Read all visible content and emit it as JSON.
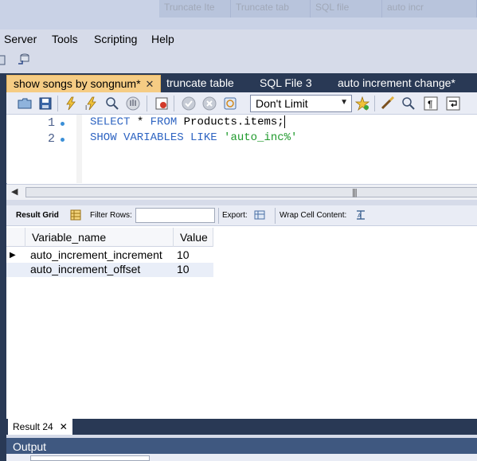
{
  "menu": {
    "items": [
      "Server",
      "Tools",
      "Scripting",
      "Help"
    ]
  },
  "background_tabs": [
    "Truncate Ite",
    "Truncate tab",
    "SQL file",
    "auto incr"
  ],
  "file_tabs": [
    {
      "label": "show songs by songnum*",
      "active": true
    },
    {
      "label": "truncate table",
      "active": false
    },
    {
      "label": "SQL File 3",
      "active": false
    },
    {
      "label": "auto increment change*",
      "active": false
    }
  ],
  "editor_toolbar": {
    "limit_value": "Don't Limit"
  },
  "editor": {
    "line_numbers": [
      "1",
      "2"
    ],
    "line1": {
      "kw1": "SELECT",
      "rest1": " * ",
      "kw2": "FROM",
      "ident": " Products.items;"
    },
    "line2": {
      "kw1": "SHOW VARIABLES LIKE",
      "str": "'auto_inc%'"
    }
  },
  "result_toolbar": {
    "result_grid": "Result Grid",
    "filter_rows": "Filter Rows:",
    "export": "Export:",
    "wrap_cell": "Wrap Cell Content:"
  },
  "grid": {
    "columns": [
      "Variable_name",
      "Value"
    ],
    "rows": [
      [
        "auto_increment_increment",
        "10"
      ],
      [
        "auto_increment_offset",
        "10"
      ]
    ]
  },
  "result_tab": "Result 24",
  "output_label": "Output"
}
